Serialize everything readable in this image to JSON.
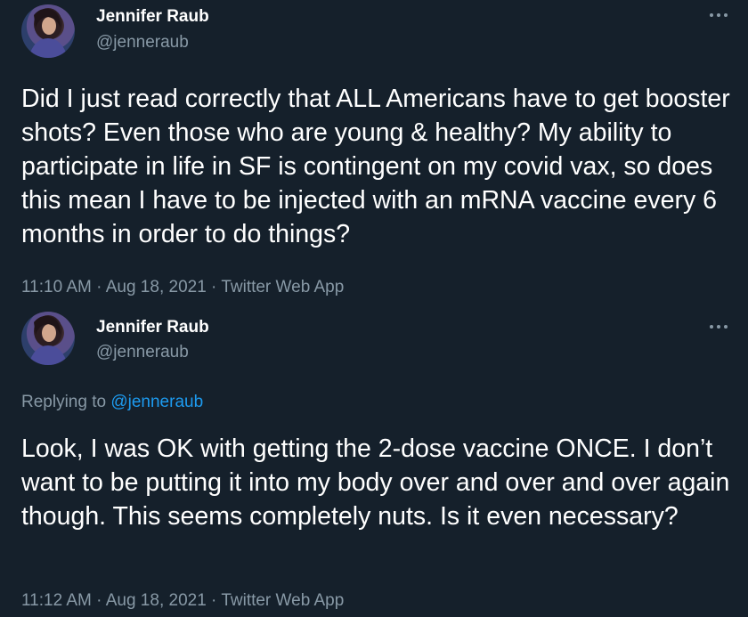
{
  "tweets": [
    {
      "author_name": "Jennifer Raub",
      "author_handle": "@jenneraub",
      "text": "Did I just read correctly that ALL Americans have to get booster shots? Even those who are young & healthy? My ability to participate in life in SF is contingent on my covid vax, so does this mean I have to be injected with an mRNA vaccine every 6 months in order to do things?",
      "time": "11:10 AM",
      "date": "Aug 18, 2021",
      "source": "Twitter Web App",
      "separator": " · "
    },
    {
      "author_name": "Jennifer Raub",
      "author_handle": "@jenneraub",
      "replying_label": "Replying to ",
      "replying_to": "@jenneraub",
      "text": "Look, I was OK with getting the 2-dose vaccine ONCE. I don’t want to be putting it into my body over and over and over again though. This seems completely nuts. Is it even necessary?",
      "time": "11:12 AM",
      "date": "Aug 18, 2021",
      "source": "Twitter Web App",
      "separator": " · "
    }
  ],
  "colors": {
    "background": "#15202b",
    "primary_text": "#ffffff",
    "secondary_text": "#8899a6",
    "accent": "#1d9bf0"
  },
  "icons": {
    "more": "more-horizontal-icon"
  }
}
